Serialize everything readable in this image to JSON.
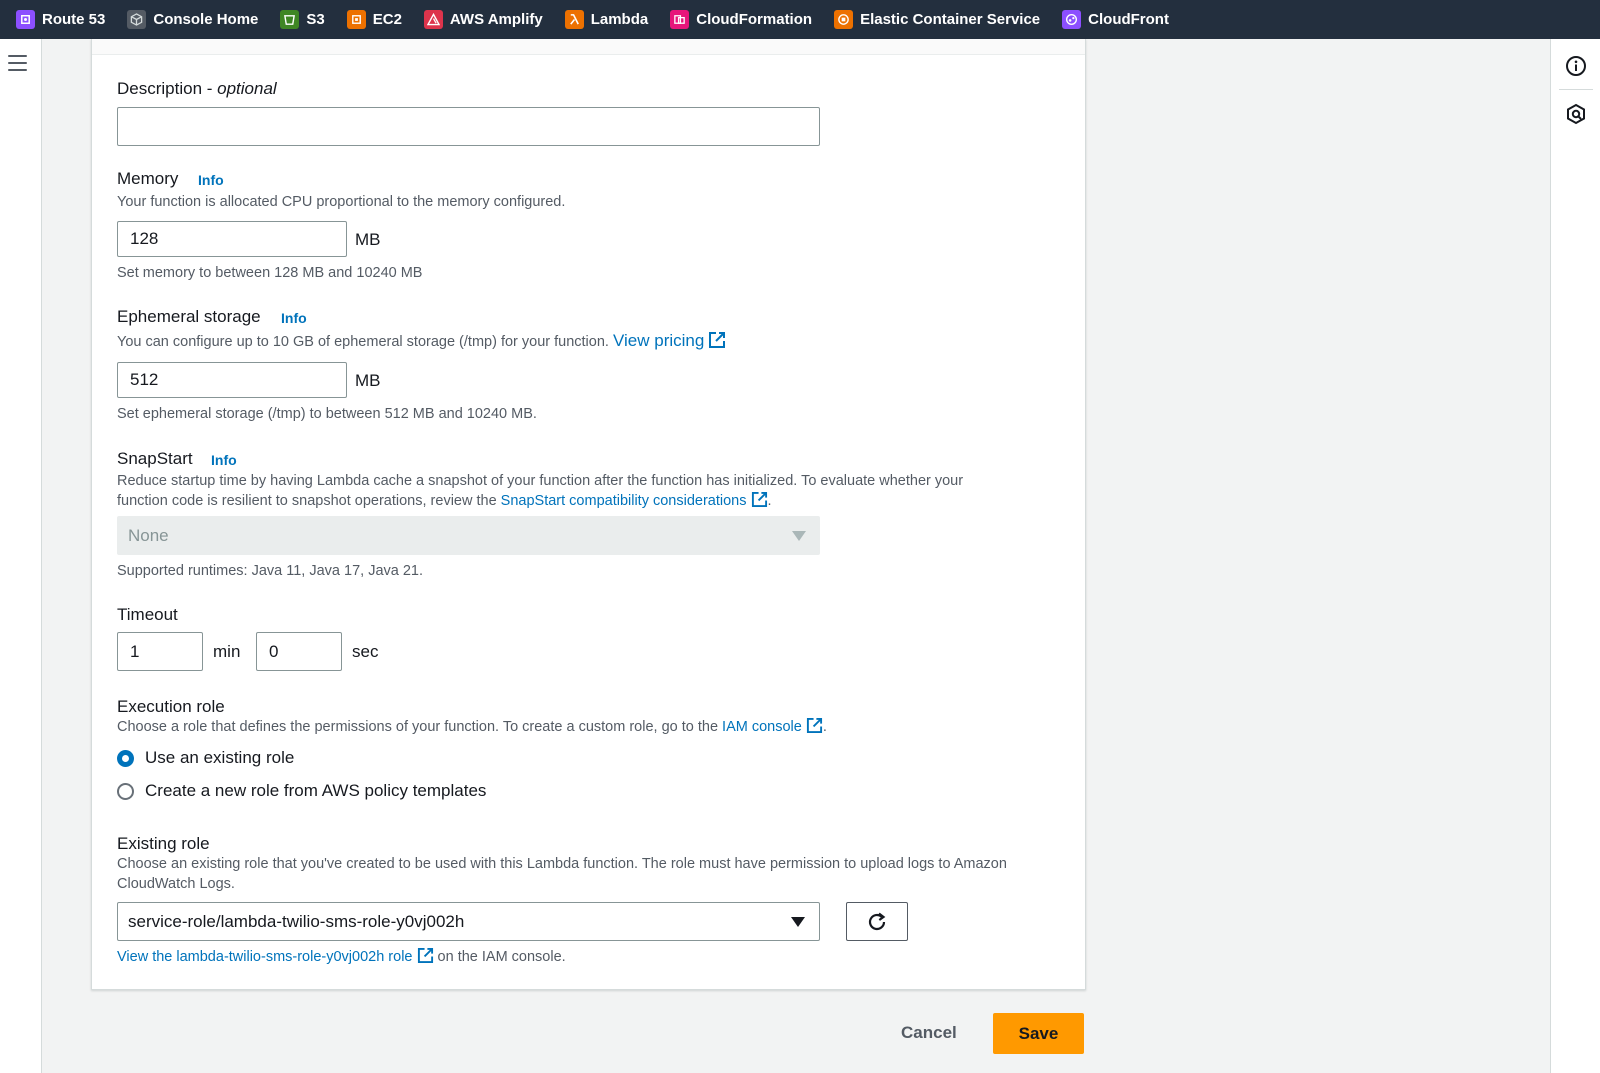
{
  "favorites_bar": {
    "items": [
      {
        "label": "Route 53",
        "icon": "route53-icon",
        "color": "#8c4fff"
      },
      {
        "label": "Console Home",
        "icon": "cube-icon",
        "color": "#545b64"
      },
      {
        "label": "S3",
        "icon": "s3-bucket-icon",
        "color": "#3f8624"
      },
      {
        "label": "EC2",
        "icon": "ec2-icon",
        "color": "#ed7100"
      },
      {
        "label": "AWS Amplify",
        "icon": "amplify-icon",
        "color": "#dd344c"
      },
      {
        "label": "Lambda",
        "icon": "lambda-icon",
        "color": "#ed7100"
      },
      {
        "label": "CloudFormation",
        "icon": "cloudformation-icon",
        "color": "#e7157b"
      },
      {
        "label": "Elastic Container Service",
        "icon": "ecs-icon",
        "color": "#ed7100"
      },
      {
        "label": "CloudFront",
        "icon": "cloudfront-icon",
        "color": "#8c4fff"
      }
    ]
  },
  "form": {
    "description": {
      "label": "Description - ",
      "label_optional": "optional",
      "value": ""
    },
    "memory": {
      "label": "Memory",
      "info": "Info",
      "help": "Your function is allocated CPU proportional to the memory configured.",
      "value": "128",
      "unit": "MB",
      "constraint": "Set memory to between 128 MB and 10240 MB"
    },
    "ephemeral_storage": {
      "label": "Ephemeral storage",
      "info": "Info",
      "help": "You can configure up to 10 GB of ephemeral storage (/tmp) for your function.",
      "help_link": "View pricing",
      "value": "512",
      "unit": "MB",
      "constraint": "Set ephemeral storage (/tmp) to between 512 MB and 10240 MB."
    },
    "snapstart": {
      "label": "SnapStart",
      "info": "Info",
      "help_line1": "Reduce startup time by having Lambda cache a snapshot of your function after the function has initialized. To evaluate whether your",
      "help_line2": "function code is resilient to snapshot operations, review the",
      "help_link": "SnapStart compatibility considerations",
      "help_end": ".",
      "selected": "None",
      "supported": "Supported runtimes: Java 11, Java 17, Java 21."
    },
    "timeout": {
      "label": "Timeout",
      "min_value": "1",
      "min_unit": "min",
      "sec_value": "0",
      "sec_unit": "sec"
    },
    "execution_role": {
      "label": "Execution role",
      "help": "Choose a role that defines the permissions of your function. To create a custom role, go to the",
      "help_link": "IAM console",
      "help_end": ".",
      "options": [
        {
          "label": "Use an existing role",
          "selected": true
        },
        {
          "label": "Create a new role from AWS policy templates",
          "selected": false
        }
      ]
    },
    "existing_role": {
      "label": "Existing role",
      "help_line1": "Choose an existing role that you've created to be used with this Lambda function. The role must have permission to upload logs to Amazon",
      "help_line2": "CloudWatch Logs.",
      "selected": "service-role/lambda-twilio-sms-role-y0vj002h",
      "view_link": "View the lambda-twilio-sms-role-y0vj002h role",
      "view_suffix": "on the IAM console."
    }
  },
  "actions": {
    "cancel": "Cancel",
    "save": "Save"
  }
}
